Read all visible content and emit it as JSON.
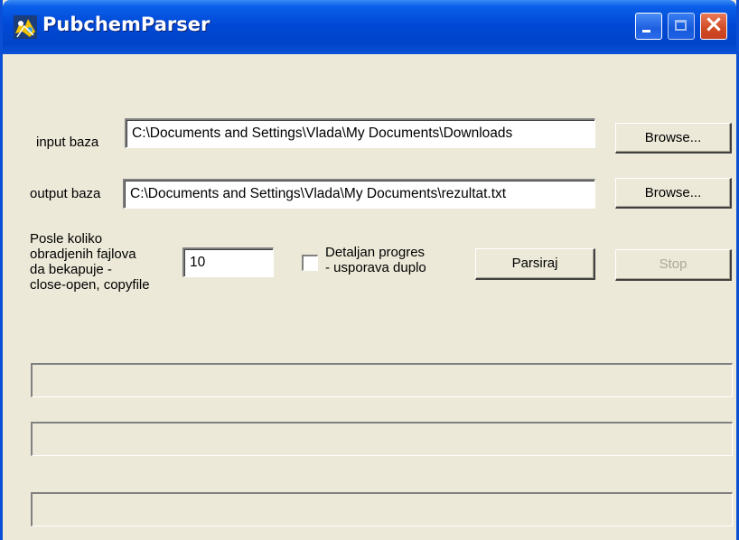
{
  "window": {
    "title": "PubchemParser"
  },
  "form": {
    "input_label": "input baza",
    "input_value": "C:\\Documents and Settings\\Vlada\\My Documents\\Downloads",
    "input_browse": "Browse...",
    "output_label": "output baza",
    "output_value": "C:\\Documents and Settings\\Vlada\\My Documents\\rezultat.txt",
    "output_browse": "Browse...",
    "backup_label_lines": [
      "Posle koliko",
      "obradjenih fajlova",
      "da bekapuje -",
      "close-open, copyfile"
    ],
    "backup_value": "10",
    "detail_label_lines": [
      "Detaljan progres",
      "- usporava duplo"
    ],
    "detail_checked": false,
    "parse_button": "Parsiraj",
    "stop_button": "Stop"
  },
  "progress": [
    0,
    0,
    0
  ],
  "colors": {
    "titlebar": "#0049d6",
    "window_bg": "#ece9d8",
    "close_button": "#d04a25"
  },
  "icons": [
    "app-icon",
    "minimize-icon",
    "maximize-icon",
    "close-icon"
  ]
}
